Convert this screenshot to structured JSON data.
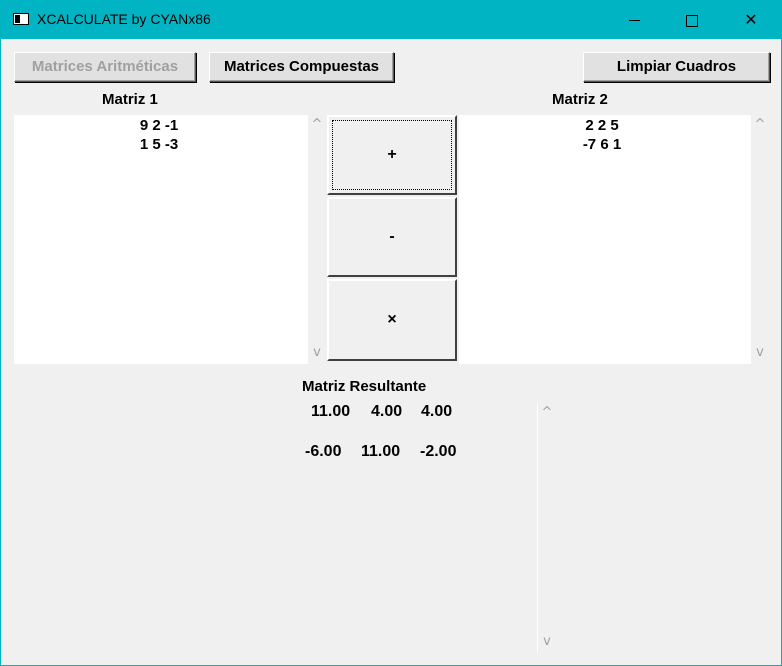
{
  "window": {
    "title": "XCALCULATE by CYANx86",
    "min_icon": "minimize-icon",
    "max_icon": "maximize-icon",
    "close_label": "✕",
    "titlebar_color": "#00b4c4"
  },
  "toolbar": {
    "aritmeticas_label": "Matrices Aritméticas",
    "compuestas_label": "Matrices Compuestas",
    "limpiar_label": "Limpiar Cuadros"
  },
  "matriz1": {
    "label": "Matriz 1",
    "rows": [
      "9 2 -1",
      "1 5 -3"
    ]
  },
  "matriz2": {
    "label": "Matriz 2",
    "rows": [
      "2 2 5",
      "-7 6 1"
    ]
  },
  "operations": {
    "add": "+",
    "subtract": "-",
    "multiply": "×"
  },
  "resultado": {
    "label": "Matriz Resultante",
    "rows": [
      [
        "11.00",
        "4.00",
        "4.00"
      ],
      [
        "-6.00",
        "11.00",
        "-2.00"
      ]
    ]
  },
  "scroll": {
    "up": "^",
    "down": "v"
  }
}
